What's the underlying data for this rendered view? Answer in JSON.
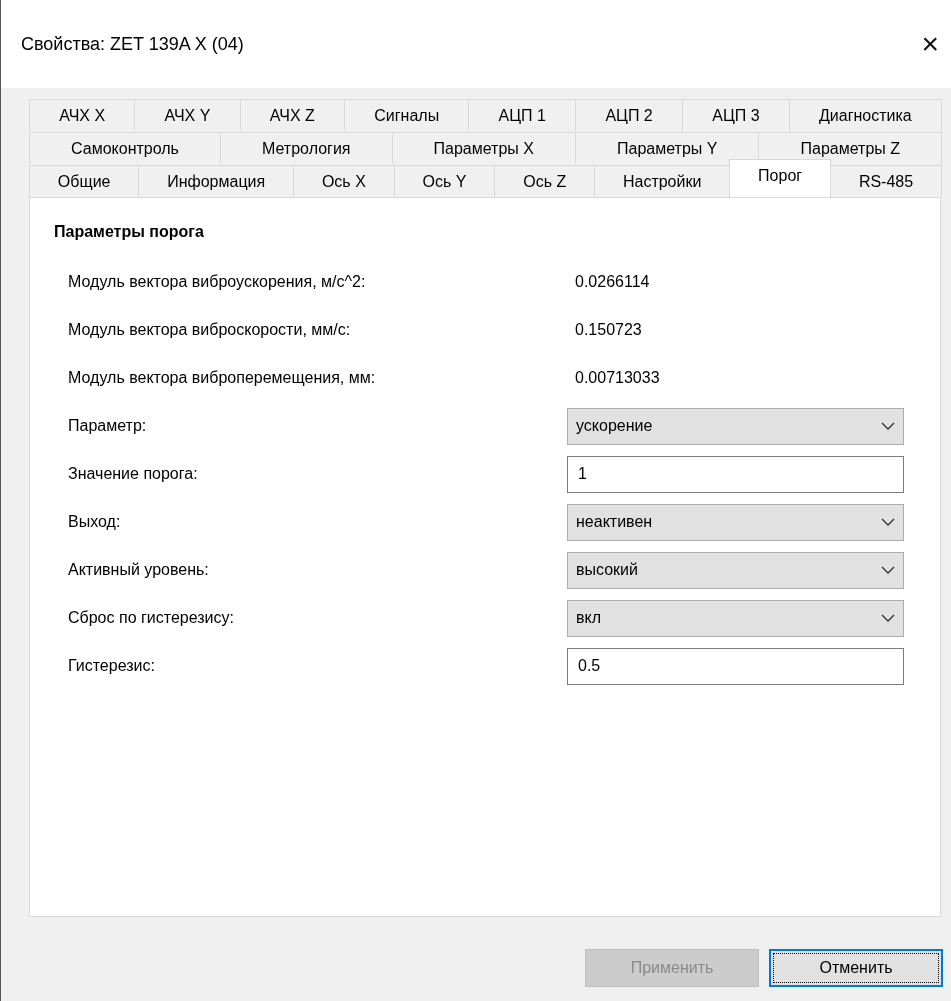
{
  "window": {
    "title": "Свойства: ZET 139A X (04)",
    "close": "×"
  },
  "tab_rows": [
    [
      {
        "label": "АЧХ X",
        "selected": false
      },
      {
        "label": "АЧХ Y",
        "selected": false
      },
      {
        "label": "АЧХ Z",
        "selected": false
      },
      {
        "label": "Сигналы",
        "selected": false
      },
      {
        "label": "АЦП 1",
        "selected": false
      },
      {
        "label": "АЦП 2",
        "selected": false
      },
      {
        "label": "АЦП 3",
        "selected": false
      },
      {
        "label": "Диагностика",
        "selected": false
      }
    ],
    [
      {
        "label": "Самоконтроль",
        "selected": false
      },
      {
        "label": "Метрология",
        "selected": false
      },
      {
        "label": "Параметры X",
        "selected": false
      },
      {
        "label": "Параметры Y",
        "selected": false
      },
      {
        "label": "Параметры Z",
        "selected": false
      }
    ],
    [
      {
        "label": "Общие",
        "selected": false
      },
      {
        "label": "Информация",
        "selected": false
      },
      {
        "label": "Ось X",
        "selected": false
      },
      {
        "label": "Ось Y",
        "selected": false
      },
      {
        "label": "Ось Z",
        "selected": false
      },
      {
        "label": "Настройки",
        "selected": false
      },
      {
        "label": "Порог",
        "selected": true
      },
      {
        "label": "RS-485",
        "selected": false
      }
    ]
  ],
  "section_title": "Параметры порога",
  "rows": [
    {
      "label": "Модуль вектора виброускорения, м/с^2:",
      "kind": "value",
      "value": "0.0266114"
    },
    {
      "label": "Модуль вектора виброскорости, мм/с:",
      "kind": "value",
      "value": "0.150723"
    },
    {
      "label": "Модуль вектора виброперемещения, мм:",
      "kind": "value",
      "value": "0.00713033"
    },
    {
      "label": "Параметр:",
      "kind": "select",
      "value": "ускорение"
    },
    {
      "label": "Значение порога:",
      "kind": "input",
      "value": "1"
    },
    {
      "label": "Выход:",
      "kind": "select",
      "value": "неактивен"
    },
    {
      "label": "Активный уровень:",
      "kind": "select",
      "value": "высокий"
    },
    {
      "label": "Сброс по гистерезису:",
      "kind": "select",
      "value": "вкл"
    },
    {
      "label": "Гистерезис:",
      "kind": "input",
      "value": "0.5"
    }
  ],
  "buttons": [
    {
      "label": "Применить",
      "disabled": true,
      "default": false
    },
    {
      "label": "Отменить",
      "disabled": false,
      "default": true
    }
  ]
}
